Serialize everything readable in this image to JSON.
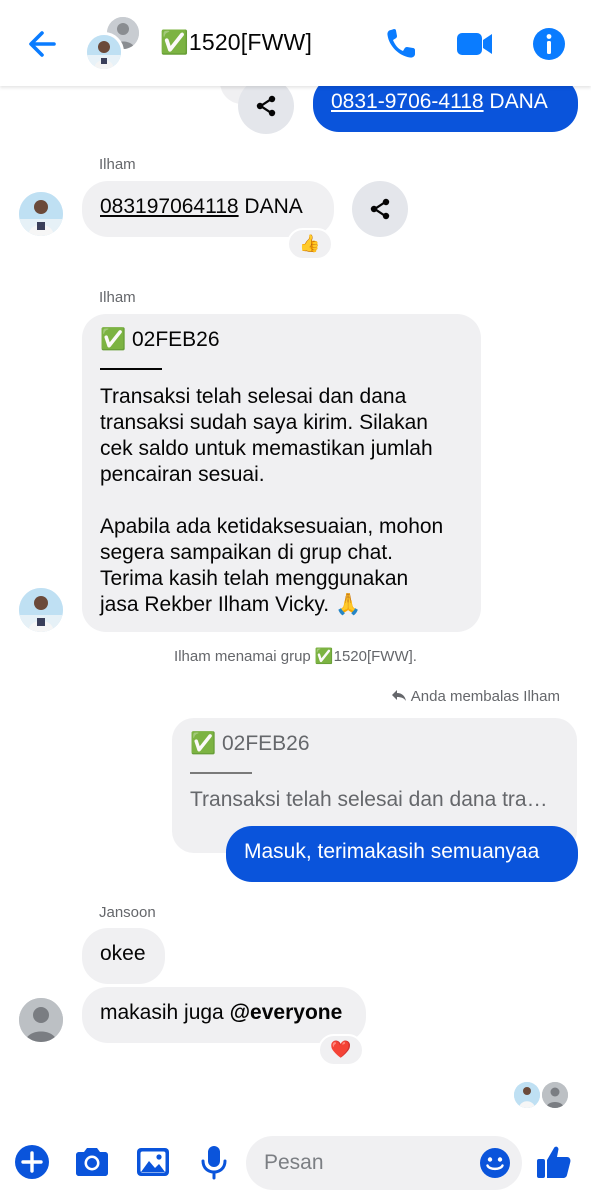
{
  "header": {
    "title": "✅1520[FWW]",
    "accent": "#0a7cff"
  },
  "messages": {
    "top_out": {
      "number": "0831-9706-4118",
      "suffix": " DANA"
    },
    "m1": {
      "sender": "Ilham",
      "number": "083197064118",
      "suffix": " DANA",
      "reaction": "👍"
    },
    "m2": {
      "sender": "Ilham",
      "header": "✅ 02FEB26",
      "lines": [
        "Transaksi telah selesai dan dana",
        "transaksi sudah saya kirim. Silakan",
        "cek saldo untuk memastikan jumlah",
        "pencairan sesuai.",
        "",
        "Apabila ada ketidaksesuaian, mohon",
        "segera sampaikan di grup chat.",
        "Terima kasih telah menggunakan",
        "jasa Rekber Ilham Vicky. 🙏"
      ]
    },
    "system_note": "Ilham menamai grup ✅1520[FWW].",
    "reply": {
      "note": "Anda membalas Ilham",
      "quote_header": "✅ 02FEB26",
      "quote_text": "Transaksi telah selesai dan dana tra…",
      "text": "Masuk, terimakasih semuanyaa"
    },
    "m3": {
      "sender": "Jansoon",
      "text1": "okee",
      "text2_prefix": "makasih juga ",
      "mention": "@everyone",
      "reaction": "❤️"
    }
  },
  "composer": {
    "placeholder": "Pesan"
  },
  "colors": {
    "outgoing_bubble": "#0a54db",
    "incoming_bubble": "#f0f0f2",
    "icon_blue": "#0a54db"
  }
}
